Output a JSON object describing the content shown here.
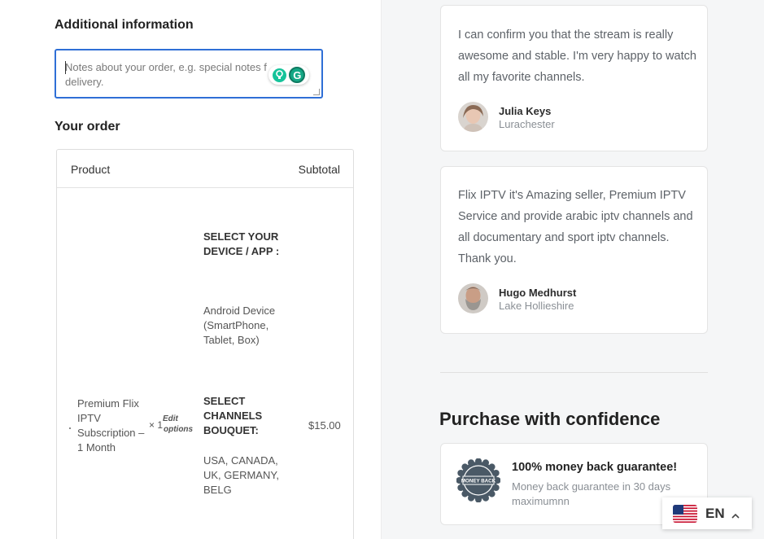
{
  "checkout": {
    "additional_heading": "Additional information",
    "notes_placeholder": "Notes about your order, e.g. special notes f… delivery.",
    "notes_line1": "Notes about your order, e.g. special notes f",
    "notes_line2": "delivery.",
    "your_order_heading": "Your order",
    "table": {
      "col_product": "Product",
      "col_subtotal": "Subtotal"
    },
    "item": {
      "name": "Premium Flix IPTV Subscription – 1 Month",
      "qty": "× 1",
      "edit_line1": "Edit",
      "edit_line2": "options",
      "meta": [
        {
          "key": "SELECT YOUR DEVICE / APP :",
          "value": "Android Device (SmartPhone, Tablet, Box)"
        },
        {
          "key": "SELECT CHANNELS BOUQUET:",
          "value": "USA, CANADA, UK, GERMANY, BELG"
        }
      ],
      "price": "$15.00"
    }
  },
  "testimonials": [
    {
      "quote": "I can confirm you that the stream is really awesome and stable. I'm very happy to watch all my favorite channels.",
      "name": "Julia Keys",
      "place": "Lurachester"
    },
    {
      "quote": "Flix IPTV it's Amazing seller, Premium IPTV Service and provide arabic iptv channels and all documentary and sport iptv channels. Thank you.",
      "name": "Hugo Medhurst",
      "place": "Lake Hollieshire"
    }
  ],
  "confidence": {
    "heading": "Purchase with confidence",
    "guarantee_title": "100% money back guarantee!",
    "guarantee_sub": "Money back guarantee in 30 days maximumnn",
    "badge_text": "MONEY BACK"
  },
  "language": {
    "code": "EN",
    "flag_icon": "us-flag-icon"
  },
  "colors": {
    "focus_border": "#2f6fd6",
    "right_bg": "#f5f6f7",
    "badge": "#4a5966"
  }
}
